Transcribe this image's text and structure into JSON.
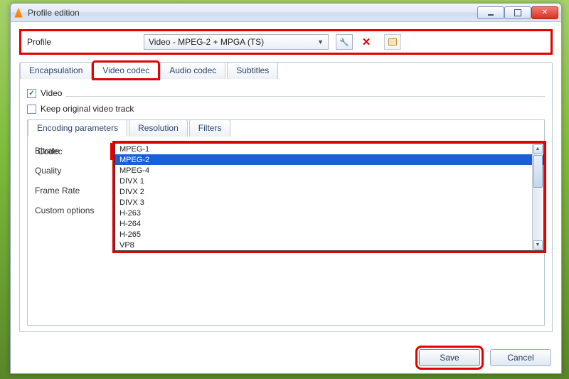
{
  "window": {
    "title": "Profile edition"
  },
  "profile": {
    "label": "Profile",
    "selected": "Video - MPEG-2 + MPGA (TS)"
  },
  "tabs": {
    "encapsulation": "Encapsulation",
    "video_codec": "Video codec",
    "audio_codec": "Audio codec",
    "subtitles": "Subtitles"
  },
  "video_panel": {
    "checkbox_video": "Video",
    "checkbox_keep": "Keep original video track"
  },
  "subtabs": {
    "encoding": "Encoding parameters",
    "resolution": "Resolution",
    "filters": "Filters"
  },
  "fields": {
    "codec": "Codec",
    "bitrate": "Bitrate",
    "quality": "Quality",
    "frame_rate": "Frame Rate",
    "custom": "Custom options"
  },
  "codec_selected": "MPEG-2",
  "codec_options": [
    "MPEG-1",
    "MPEG-2",
    "MPEG-4",
    "DIVX 1",
    "DIVX 2",
    "DIVX 3",
    "H-263",
    "H-264",
    "H-265",
    "VP8"
  ],
  "codec_highlight_index": 1,
  "buttons": {
    "save": "Save",
    "cancel": "Cancel"
  }
}
